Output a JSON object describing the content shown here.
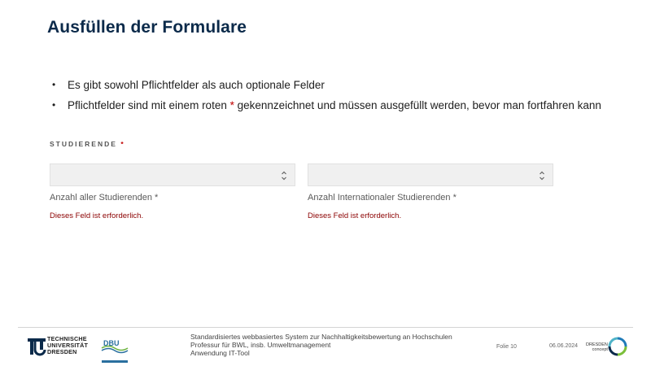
{
  "slide": {
    "title": "Ausfüllen der Formulare",
    "bullets": [
      {
        "text": "Es gibt sowohl Pflichtfelder als auch optionale Felder"
      },
      {
        "text_before": "Pflichtfelder sind mit einem roten ",
        "asterisk": "*",
        "text_after": " gekennzeichnet und müssen ausgefüllt werden, bevor man fortfahren kann"
      }
    ]
  },
  "form": {
    "section_label": "STUDIERENDE",
    "required_marker": "*",
    "fields": [
      {
        "label": "Anzahl aller Studierenden *",
        "value": "",
        "error": "Dieses Feld ist erforderlich."
      },
      {
        "label": "Anzahl Internationaler Studierenden *",
        "value": "",
        "error": "Dieses Feld ist erforderlich."
      }
    ]
  },
  "footer": {
    "tu_logo_lines": [
      "TECHNISCHE",
      "UNIVERSITÄT",
      "DRESDEN"
    ],
    "dbu_text": "DBU",
    "lines": [
      "Standardisiertes webbasiertes System zur Nachhaltigkeitsbewertung an Hochschulen",
      "Professur für BWL, insb. Umweltmanagement",
      "Anwendung IT-Tool"
    ],
    "slide_number": "Folie 10",
    "date": "06.06.2024",
    "dresden_concept_lines": [
      "DRESDEN",
      "concept"
    ]
  },
  "colors": {
    "title": "#0b2a4a",
    "required": "#c00000",
    "error": "#8b0000"
  }
}
